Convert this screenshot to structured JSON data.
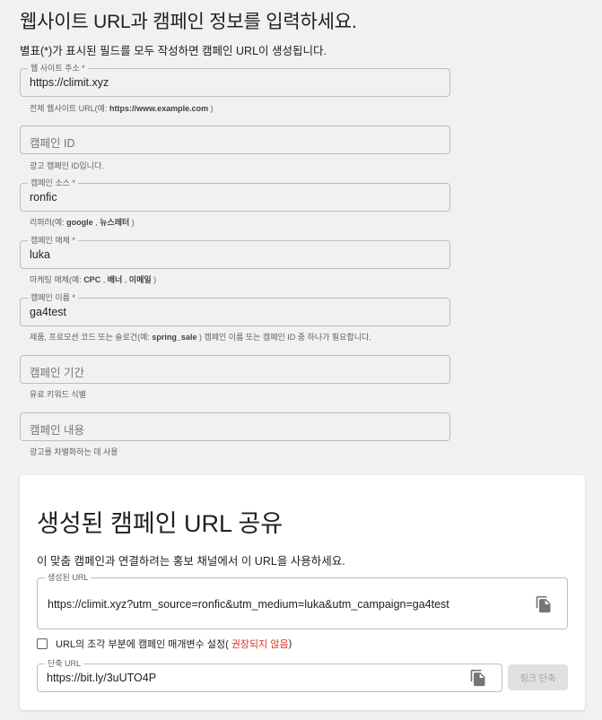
{
  "header": {
    "title": "웹사이트 URL과 캠페인 정보를 입력하세요.",
    "subtitle": "별표(*)가 표시된 필드를 모두 작성하면 캠페인 URL이 생성됩니다."
  },
  "form": {
    "website": {
      "label": "웹 사이트 주소 *",
      "value": "https://climit.xyz",
      "hint_pre": "전체 웹사이트 URL(예: ",
      "hint_bold": "https://www.example.com",
      "hint_post": " )"
    },
    "campaign_id": {
      "placeholder": "캠페인 ID",
      "hint": "광고 캠페인 ID입니다."
    },
    "source": {
      "label": "캠페인 소스 *",
      "value": "ronfic",
      "hint_pre": "리퍼러(예: ",
      "hint_bold": "google",
      "hint_mid": " , ",
      "hint_bold2": "뉴스레터",
      "hint_post": " )"
    },
    "medium": {
      "label": "캠페인 매체 *",
      "value": "luka",
      "hint_pre": "마케팅 매체(예: ",
      "hint_bold": "CPC",
      "hint_mid": " , ",
      "hint_bold2": "배너",
      "hint_mid2": " , ",
      "hint_bold3": "이메일",
      "hint_post": " )"
    },
    "name": {
      "label": "캠페인 이름 *",
      "value": "ga4test",
      "hint_pre": "제품, 프로모션 코드 또는 슬로건(예: ",
      "hint_bold": "spring_sale",
      "hint_post": " ) 캠페인 이름 또는 캠페인 ID 중 하나가 필요합니다."
    },
    "term": {
      "placeholder": "캠페인 기간",
      "hint": "유료 키워드 식별"
    },
    "content": {
      "placeholder": "캠페인 내용",
      "hint": "광고를 차별화하는 데 사용"
    }
  },
  "share": {
    "title": "생성된 캠페인 URL 공유",
    "description": "이 맞춤 캠페인과 연결하려는 홍보 채널에서 이 URL을 사용하세요.",
    "generated_label": "생성된 URL",
    "generated_url": "https://climit.xyz?utm_source=ronfic&utm_medium=luka&utm_campaign=ga4test",
    "checkbox_label": "URL의 조각 부분에 캠페인 매개변수 설정( ",
    "checkbox_warning": "권장되지 않음",
    "checkbox_suffix": " )",
    "short_label": "단축 URL",
    "short_url": "https://bit.ly/3uUTO4P",
    "shorten_button": "링크 단축"
  },
  "icons": {
    "copy": "copy-icon"
  },
  "colors": {
    "warning": "#d93025",
    "disabled_button": "#e0e0e0"
  }
}
